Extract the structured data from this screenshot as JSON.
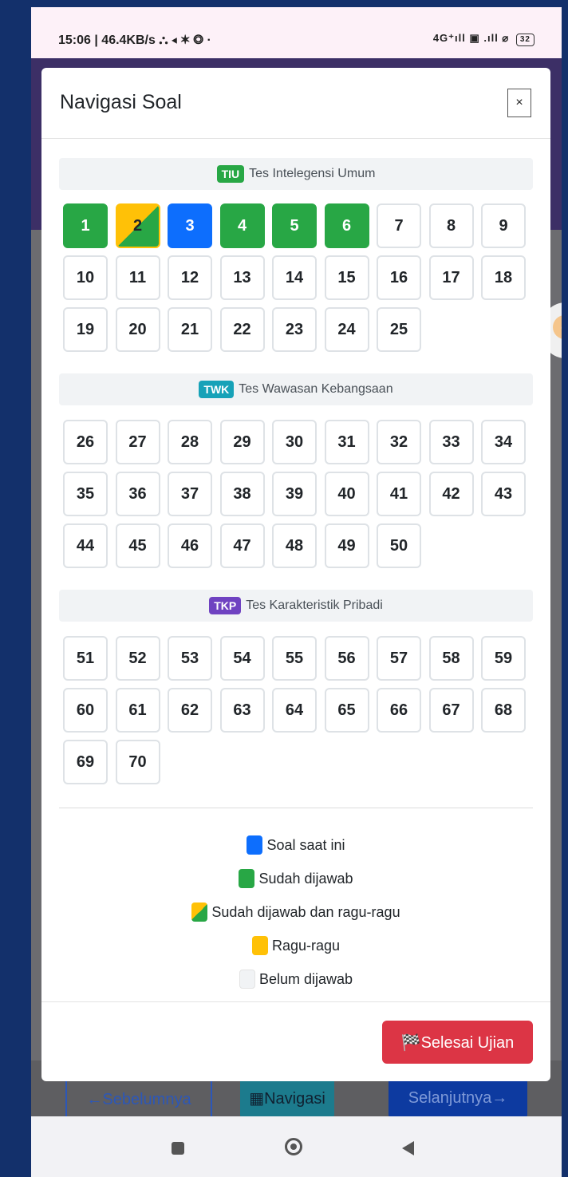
{
  "status_bar": {
    "left_text": "15:06 | 46.4KB/s ⛬ ◂ ✶ ◎ ·",
    "right_text": "4G⁺ıll ▣ .ıll ⌀",
    "battery": "32"
  },
  "modal": {
    "title": "Navigasi Soal",
    "close_label": "×"
  },
  "sections": [
    {
      "badge": "TIU",
      "badge_color": "#28a745",
      "title": "Tes Intelegensi Umum",
      "questions": [
        {
          "n": "1",
          "state": "answered"
        },
        {
          "n": "2",
          "state": "answered-doubt"
        },
        {
          "n": "3",
          "state": "current"
        },
        {
          "n": "4",
          "state": "answered"
        },
        {
          "n": "5",
          "state": "answered"
        },
        {
          "n": "6",
          "state": "answered"
        },
        {
          "n": "7",
          "state": "empty"
        },
        {
          "n": "8",
          "state": "empty"
        },
        {
          "n": "9",
          "state": "empty"
        },
        {
          "n": "10",
          "state": "empty"
        },
        {
          "n": "11",
          "state": "empty"
        },
        {
          "n": "12",
          "state": "empty"
        },
        {
          "n": "13",
          "state": "empty"
        },
        {
          "n": "14",
          "state": "empty"
        },
        {
          "n": "15",
          "state": "empty"
        },
        {
          "n": "16",
          "state": "empty"
        },
        {
          "n": "17",
          "state": "empty"
        },
        {
          "n": "18",
          "state": "empty"
        },
        {
          "n": "19",
          "state": "empty"
        },
        {
          "n": "20",
          "state": "empty"
        },
        {
          "n": "21",
          "state": "empty"
        },
        {
          "n": "22",
          "state": "empty"
        },
        {
          "n": "23",
          "state": "empty"
        },
        {
          "n": "24",
          "state": "empty"
        },
        {
          "n": "25",
          "state": "empty"
        }
      ]
    },
    {
      "badge": "TWK",
      "badge_color": "#17a2b8",
      "title": "Tes Wawasan Kebangsaan",
      "questions": [
        {
          "n": "26",
          "state": "empty"
        },
        {
          "n": "27",
          "state": "empty"
        },
        {
          "n": "28",
          "state": "empty"
        },
        {
          "n": "29",
          "state": "empty"
        },
        {
          "n": "30",
          "state": "empty"
        },
        {
          "n": "31",
          "state": "empty"
        },
        {
          "n": "32",
          "state": "empty"
        },
        {
          "n": "33",
          "state": "empty"
        },
        {
          "n": "34",
          "state": "empty"
        },
        {
          "n": "35",
          "state": "empty"
        },
        {
          "n": "36",
          "state": "empty"
        },
        {
          "n": "37",
          "state": "empty"
        },
        {
          "n": "38",
          "state": "empty"
        },
        {
          "n": "39",
          "state": "empty"
        },
        {
          "n": "40",
          "state": "empty"
        },
        {
          "n": "41",
          "state": "empty"
        },
        {
          "n": "42",
          "state": "empty"
        },
        {
          "n": "43",
          "state": "empty"
        },
        {
          "n": "44",
          "state": "empty"
        },
        {
          "n": "45",
          "state": "empty"
        },
        {
          "n": "46",
          "state": "empty"
        },
        {
          "n": "47",
          "state": "empty"
        },
        {
          "n": "48",
          "state": "empty"
        },
        {
          "n": "49",
          "state": "empty"
        },
        {
          "n": "50",
          "state": "empty"
        }
      ]
    },
    {
      "badge": "TKP",
      "badge_color": "#6f42c1",
      "title": "Tes Karakteristik Pribadi",
      "questions": [
        {
          "n": "51",
          "state": "empty"
        },
        {
          "n": "52",
          "state": "empty"
        },
        {
          "n": "53",
          "state": "empty"
        },
        {
          "n": "54",
          "state": "empty"
        },
        {
          "n": "55",
          "state": "empty"
        },
        {
          "n": "56",
          "state": "empty"
        },
        {
          "n": "57",
          "state": "empty"
        },
        {
          "n": "58",
          "state": "empty"
        },
        {
          "n": "59",
          "state": "empty"
        },
        {
          "n": "60",
          "state": "empty"
        },
        {
          "n": "61",
          "state": "empty"
        },
        {
          "n": "62",
          "state": "empty"
        },
        {
          "n": "63",
          "state": "empty"
        },
        {
          "n": "64",
          "state": "empty"
        },
        {
          "n": "65",
          "state": "empty"
        },
        {
          "n": "66",
          "state": "empty"
        },
        {
          "n": "67",
          "state": "empty"
        },
        {
          "n": "68",
          "state": "empty"
        },
        {
          "n": "69",
          "state": "empty"
        },
        {
          "n": "70",
          "state": "empty"
        }
      ]
    }
  ],
  "legend": {
    "current": "Soal saat ini",
    "answered": "Sudah dijawab",
    "answered_doubt": "Sudah dijawab dan ragu-ragu",
    "doubt": "Ragu-ragu",
    "unanswered": "Belum dijawab"
  },
  "footer": {
    "finish_label": "🏁Selesai Ujian"
  },
  "bottom_nav": {
    "prev_label": "←Sebelumnya",
    "nav_label": "▦Navigasi",
    "next_label": "Selanjutnya→"
  },
  "colors": {
    "answered": "#28a745",
    "current": "#0d6efd",
    "doubt": "#ffc107",
    "finish": "#dc3545"
  }
}
